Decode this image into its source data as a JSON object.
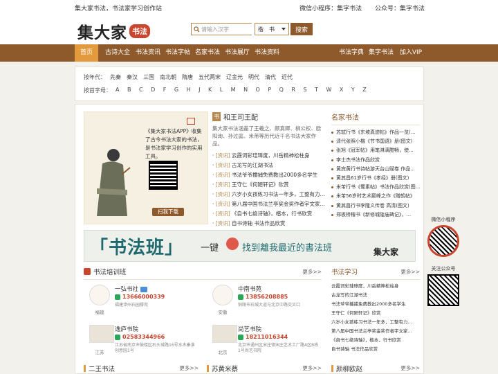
{
  "topbar": {
    "slogan": "集大家书法，书法家学习创作站",
    "mini_program": "微信小程序：集字书法",
    "official_account": "公众号：集字书法"
  },
  "logo": {
    "text": "集大家",
    "seal": "书法"
  },
  "search": {
    "placeholder": "请输入汉字",
    "select_value": "楷　书",
    "button": "搜索"
  },
  "nav": {
    "left": [
      "首页",
      "古诗大全",
      "书法资讯",
      "书法字帖",
      "名家书法",
      "书法展厅",
      "书法资料"
    ],
    "right": [
      "书法字典",
      "集字书法",
      "加入VIP"
    ]
  },
  "filter": {
    "dynasty_label": "按年代：",
    "dynasties": [
      "先秦",
      "秦汉",
      "三国",
      "南北朝",
      "隋唐",
      "五代两宋",
      "辽金元",
      "明代",
      "清代",
      "近代"
    ],
    "letter_label": "按首字母：",
    "letters": [
      "A",
      "B",
      "C",
      "D",
      "F",
      "G",
      "H",
      "J",
      "K",
      "L",
      "M",
      "N",
      "O",
      "P",
      "Q",
      "R",
      "S",
      "T",
      "W",
      "X",
      "Y",
      "Z"
    ]
  },
  "promo": {
    "text": "《集大家书法APP》收集了古今书法大家的书法，是书法家学习创作的实用工具。",
    "scan_button": "扫我下载"
  },
  "news": {
    "badge": "书",
    "title": "和王司王配",
    "intro": "集大家书法涵盖了王羲之、颜真卿、柳公权、欧阳询、孙过庭、米芾等历代近千名书法大家作品。",
    "tag": "[资讯]",
    "items": [
      "云霞词彩珪璋度，川岳精神松柱身",
      "古龙写的江湖书法",
      "书法爷爷播捕免费教出2000多名学生",
      "王守仁《何陋轩记》欣赏",
      "六岁小女孩练习书法一年多，工整有力...",
      "第八届中国书法兰亭奖金奖作者宇文家...",
      "《自书七绝诗轴》，楷本，行书欣赏",
      "自书诗轴 书法作品欣赏"
    ]
  },
  "famous": {
    "title": "名家书法",
    "items": [
      "苏轼行书《东坡真迹帖》作品一览(...",
      "清代张照小楷《节书国语》册(图文)",
      "张旭《冠军帖》用笔淋漓酣畅，使...",
      "李士杰书法作品欣赏",
      "黄宾黄行书诗帖游天台山赋卷 作品...",
      "黄其昌61岁行书《孝经》册(图文)",
      "米芾行书《蜀素帖》书法作品欣赏(图...",
      "米芾56岁时艺术巅峰之作《赠鹤帖》",
      "黄其昌行书李隆义传卷 高清(图文)",
      "郑板桥楷书《新修城隍庙碑记》，..."
    ]
  },
  "banner": {
    "big": "「书法班」",
    "yi": "一键",
    "slogan": "找到離我最近的書法班",
    "brand": "集大家"
  },
  "training": {
    "title": "书法培训班",
    "more": "更多>>",
    "cards": [
      {
        "name": "一弘书社",
        "phone": "13666000339",
        "addr": "福建漳州石园餐苑",
        "city": "福建"
      },
      {
        "name": "中南书苑",
        "phone": "13856208885",
        "addr": "铜陵市石城大道与北京中路交叉口",
        "city": "安徽"
      },
      {
        "name": "逸庐书院",
        "phone": "02583344966",
        "addr": "江苏省南京市鼓楼区石头城路16号水木秦淮创意园1号",
        "city": "江苏"
      },
      {
        "name": "尚艺书院",
        "phone": "18211016344",
        "addr": "北京市通州区宋庄镇宋庄艺术工厂路A区B栋1号尚艺书院",
        "city": "北京"
      }
    ]
  },
  "learn": {
    "title": "书法学习",
    "more": "更多>>",
    "items": [
      "云霞词彩珪璋度，川岳精神松柱身",
      "古龙写的江湖书法",
      "书法爷爷播捕免费教出2000多名学生",
      "王守仁《何陋轩记》欣赏",
      "六岁小女孩练习书法一年多，工整有力...",
      "第八届中国书法兰亭奖金奖作者宇文家...",
      "《自书七绝诗轴》，楷本，行书欣赏",
      "自书诗轴 书法作品欣赏"
    ]
  },
  "bottom": {
    "sections": [
      "二王书法",
      "苏黄米蔡",
      "颜柳欧赵"
    ],
    "more": "更多>>"
  },
  "side": {
    "mini_label": "微信小程序",
    "account_label": "关注公众号"
  },
  "colors": {
    "nav": "#8e5a2c",
    "nav_active": "#e29a3c",
    "accent_red": "#c9452d"
  }
}
